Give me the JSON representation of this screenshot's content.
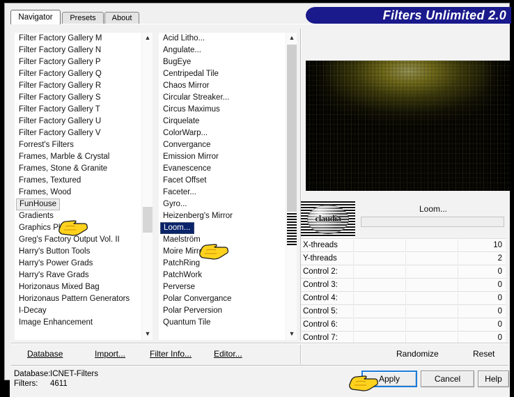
{
  "window": {
    "title": "Filters Unlimited 2.0",
    "accent_color": "#1a1a8c",
    "title_text_color": "#ffffff"
  },
  "tabs": [
    {
      "label": "Navigator",
      "active": true
    },
    {
      "label": "Presets",
      "active": false
    },
    {
      "label": "About",
      "active": false
    }
  ],
  "category_list": {
    "name": "filter-category-list",
    "selected": "FunHouse",
    "items": [
      "Filter Factory Gallery M",
      "Filter Factory Gallery N",
      "Filter Factory Gallery P",
      "Filter Factory Gallery Q",
      "Filter Factory Gallery R",
      "Filter Factory Gallery S",
      "Filter Factory Gallery T",
      "Filter Factory Gallery U",
      "Filter Factory Gallery V",
      "Forrest's Filters",
      "Frames, Marble & Crystal",
      "Frames, Stone & Granite",
      "Frames, Textured",
      "Frames, Wood",
      "FunHouse",
      "Gradients",
      "Graphics Plus",
      "Greg's Factory Output Vol. II",
      "Harry's Button Tools",
      "Harry's Power Grads",
      "Harry's Rave Grads",
      "Horizonaus Mixed Bag",
      "Horizonaus Pattern Generators",
      "I-Decay",
      "Image Enhancement"
    ]
  },
  "effect_list": {
    "name": "filter-effect-list",
    "selected": "Loom...",
    "items": [
      "Acid Litho...",
      "Angulate...",
      "BugEye",
      "Centripedal Tile",
      "Chaos Mirror",
      "Circular Streaker...",
      "Circus Maximus",
      "Cirquelate",
      "ColorWarp...",
      "Convergance",
      "Emission Mirror",
      "Evanescence",
      "Facet Offset",
      "Faceter...",
      "Gyro...",
      "Heizenberg's Mirror",
      "Loom...",
      "Maelström",
      "Moire Mirror",
      "PatchRing",
      "PatchWork",
      "Perverse",
      "Polar Convergance",
      "Polar Perversion",
      "Quantum Tile"
    ]
  },
  "preview": {
    "name": "filter-preview",
    "watermark": "claudia"
  },
  "filter_panel": {
    "current_filter": "Loom...",
    "controls": [
      {
        "label": "X-threads",
        "value": "10"
      },
      {
        "label": "Y-threads",
        "value": "2"
      },
      {
        "label": "Control 2:",
        "value": "0"
      },
      {
        "label": "Control 3:",
        "value": "0"
      },
      {
        "label": "Control 4:",
        "value": "0"
      },
      {
        "label": "Control 5:",
        "value": "0"
      },
      {
        "label": "Control 6:",
        "value": "0"
      },
      {
        "label": "Control 7:",
        "value": "0"
      }
    ]
  },
  "menu": {
    "left_items": [
      {
        "label": "Database"
      },
      {
        "label": "Import..."
      },
      {
        "label": "Filter Info..."
      },
      {
        "label": "Editor..."
      }
    ],
    "right_items": [
      {
        "label": "Randomize"
      },
      {
        "label": "Reset"
      }
    ]
  },
  "status": {
    "database_label": "Database:",
    "database_value": "ICNET-Filters",
    "filters_label": "Filters:",
    "filters_value": "4611"
  },
  "buttons": {
    "apply": "Apply",
    "cancel": "Cancel",
    "help": "Help"
  }
}
